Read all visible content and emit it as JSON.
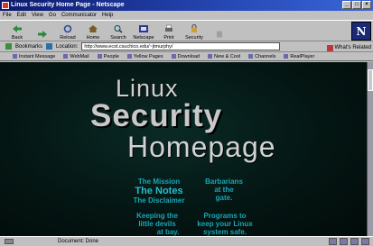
{
  "window": {
    "title": "Linux Security Home Page - Netscape"
  },
  "menu": [
    "File",
    "Edit",
    "View",
    "Go",
    "Communicator",
    "Help"
  ],
  "toolbar": {
    "buttons": [
      {
        "label": "Back",
        "icon": "back-arrow-icon"
      },
      {
        "label": "",
        "icon": "forward-arrow-icon"
      },
      {
        "label": "Reload",
        "icon": "reload-icon"
      },
      {
        "label": "Home",
        "icon": "home-icon"
      },
      {
        "label": "Search",
        "icon": "search-icon"
      },
      {
        "label": "Netscape",
        "icon": "netscape-icon"
      },
      {
        "label": "Print",
        "icon": "print-icon"
      },
      {
        "label": "Security",
        "icon": "security-icon"
      },
      {
        "label": "",
        "icon": "stop-icon"
      }
    ],
    "logo": "N"
  },
  "location": {
    "bookmarks_label": "Bookmarks",
    "location_label": "Location:",
    "url": "http://www.ecst.csuchico.edu/~jtmurphy/",
    "related_label": "What's Related"
  },
  "links": [
    "Instant Message",
    "WebMail",
    "People",
    "Yellow Pages",
    "Download",
    "New & Cool",
    "Channels",
    "RealPlayer"
  ],
  "page": {
    "title_line1": "Linux",
    "title_line2": "Security",
    "title_line3": "Homepage",
    "left_links": {
      "mission": "The Mission",
      "notes": "The Notes",
      "disclaimer": "The Disclaimer",
      "devils_1": "Keeping the",
      "devils_2": "little devils",
      "devils_3": "at bay."
    },
    "right_links": {
      "barbarians_1": "Barbarians",
      "barbarians_2": "at the",
      "barbarians_3": "gate.",
      "programs_1": "Programs to",
      "programs_2": "keep your Linux",
      "programs_3": "system safe."
    }
  },
  "status": {
    "text": "Document: Done"
  }
}
